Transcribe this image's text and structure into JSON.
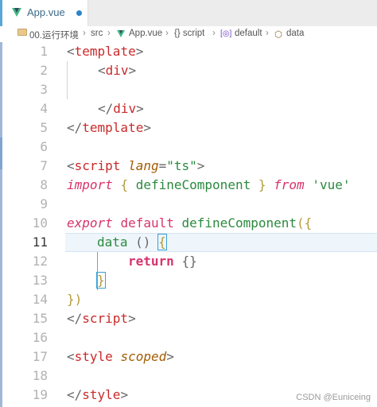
{
  "tab": {
    "label": "App.vue"
  },
  "breadcrumb": [
    "00.运行环境",
    "src",
    "App.vue",
    "{} script",
    "default",
    "data"
  ],
  "lines": {
    "n1": "1",
    "n2": "2",
    "n3": "3",
    "n4": "4",
    "n5": "5",
    "n6": "6",
    "n7": "7",
    "n8": "8",
    "n9": "9",
    "n10": "10",
    "n11": "11",
    "n12": "12",
    "n13": "13",
    "n14": "14",
    "n15": "15",
    "n16": "16",
    "n17": "17",
    "n18": "18",
    "n19": "19"
  },
  "code": {
    "l1": {
      "open": "<",
      "tag": "template",
      "close": ">"
    },
    "l2": {
      "open": "<",
      "tag": "div",
      "close": ">"
    },
    "l4": {
      "open": "</",
      "tag": "div",
      "close": ">"
    },
    "l5": {
      "open": "</",
      "tag": "template",
      "close": ">"
    },
    "l7": {
      "open": "<",
      "tag": "script",
      "attr": "lang",
      "eq": "=",
      "val": "\"ts\"",
      "close": ">"
    },
    "l8": {
      "kw": "import",
      "lb": "{",
      "name": "defineComponent",
      "rb": "}",
      "from": "from",
      "str": "'vue'"
    },
    "l10": {
      "kw": "export",
      "def": "default",
      "fn": "defineComponent",
      "paren": "(",
      "brace": "{"
    },
    "l11": {
      "name": "data",
      "parens": "()",
      "brace": "{"
    },
    "l12": {
      "kw": "return",
      "braces": "{}"
    },
    "l13": {
      "brace": "}"
    },
    "l14": {
      "text": "})"
    },
    "l15": {
      "open": "</",
      "tag": "script",
      "close": ">"
    },
    "l17": {
      "open": "<",
      "tag": "style",
      "attr": "scoped",
      "close": ">"
    },
    "l19": {
      "open": "</",
      "tag": "style",
      "close": ">"
    }
  },
  "watermark": "CSDN @Euniceing"
}
